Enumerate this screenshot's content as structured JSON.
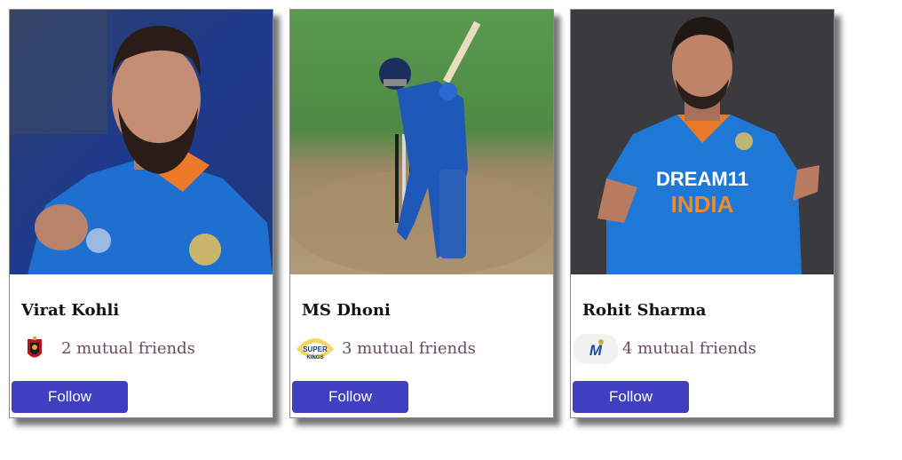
{
  "cards": [
    {
      "name": "Virat Kohli",
      "mutual": "2 mutual friends",
      "follow_label": "Follow",
      "team_icon": "rcb-logo-icon",
      "photo_bg": "#24407e"
    },
    {
      "name": "MS Dhoni",
      "mutual": "3 mutual friends",
      "follow_label": "Follow",
      "team_icon": "csk-logo-icon",
      "photo_bg": "#4f8a49"
    },
    {
      "name": "Rohit Sharma",
      "mutual": "4 mutual friends",
      "follow_label": "Follow",
      "team_icon": "mi-logo-icon",
      "photo_bg": "#3b3b3f"
    }
  ],
  "colors": {
    "button_bg": "#3f3fbf",
    "button_text": "#ffffff",
    "mutual_text": "#6b4a5e",
    "jersey_blue": "#1f6fd1"
  }
}
